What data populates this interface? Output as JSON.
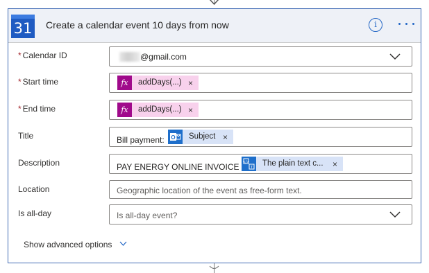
{
  "card": {
    "title": "Create a calendar event 10 days from now",
    "icon_number": "31",
    "icon": "calendar-icon",
    "info_icon": "info-icon",
    "more_icon": "more-options-icon"
  },
  "fields": {
    "calendar_id": {
      "required_mark": "*",
      "label": "Calendar ID",
      "value_suffix": "@gmail.com"
    },
    "start_time": {
      "required_mark": "*",
      "label": "Start time",
      "token_label": "addDays(...)",
      "token_icon_text": "fx"
    },
    "end_time": {
      "required_mark": "*",
      "label": "End time",
      "token_label": "addDays(...)",
      "token_icon_text": "fx"
    },
    "title": {
      "label": "Title",
      "prefix_text": "Bill payment:",
      "token_label": "Subject",
      "token_icon": "outlook-icon"
    },
    "description": {
      "label": "Description",
      "prefix_text": "PAY ENERGY ONLINE INVOICE \\N",
      "token_label": "The plain text c...",
      "token_icon": "html-to-text-icon"
    },
    "location": {
      "label": "Location",
      "placeholder": "Geographic location of the event as free-form text."
    },
    "is_all_day": {
      "label": "Is all-day",
      "placeholder": "Is all-day event?"
    }
  },
  "token_remove_glyph": "×",
  "advanced_options": {
    "label": "Show advanced options"
  },
  "colors": {
    "card_border": "#3f6ab5",
    "header_bg": "#eef1f7",
    "accent_blue": "#2266c5",
    "fx_token_bg": "#f8d1ec",
    "fx_icon_bg": "#a00a8b",
    "dynamic_token_bg": "#d8e3f7",
    "required_red": "#a4262c"
  }
}
